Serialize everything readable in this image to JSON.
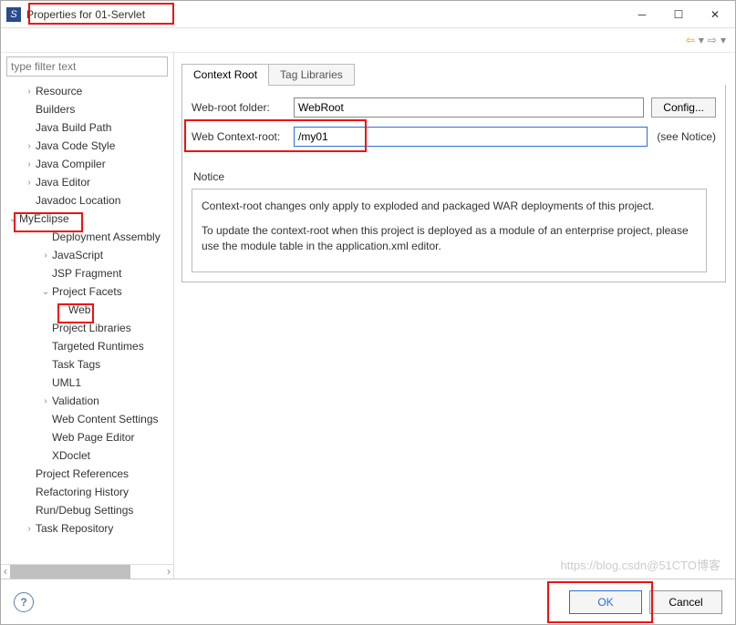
{
  "window": {
    "title": "Properties for 01-Servlet"
  },
  "filter": {
    "placeholder": "type filter text"
  },
  "tree": {
    "items": [
      {
        "label": "Resource",
        "indent": 1,
        "twisty": ">"
      },
      {
        "label": "Builders",
        "indent": 1,
        "twisty": ""
      },
      {
        "label": "Java Build Path",
        "indent": 1,
        "twisty": ""
      },
      {
        "label": "Java Code Style",
        "indent": 1,
        "twisty": ">"
      },
      {
        "label": "Java Compiler",
        "indent": 1,
        "twisty": ">"
      },
      {
        "label": "Java Editor",
        "indent": 1,
        "twisty": ">"
      },
      {
        "label": "Javadoc Location",
        "indent": 1,
        "twisty": ""
      },
      {
        "label": "MyEclipse",
        "indent": 0,
        "twisty": "v"
      },
      {
        "label": "Deployment Assembly",
        "indent": 2,
        "twisty": ""
      },
      {
        "label": "JavaScript",
        "indent": 2,
        "twisty": ">"
      },
      {
        "label": "JSP Fragment",
        "indent": 2,
        "twisty": ""
      },
      {
        "label": "Project Facets",
        "indent": 2,
        "twisty": "v"
      },
      {
        "label": "Web",
        "indent": 3,
        "twisty": ""
      },
      {
        "label": "Project Libraries",
        "indent": 2,
        "twisty": ""
      },
      {
        "label": "Targeted Runtimes",
        "indent": 2,
        "twisty": ""
      },
      {
        "label": "Task Tags",
        "indent": 2,
        "twisty": ""
      },
      {
        "label": "UML1",
        "indent": 2,
        "twisty": ""
      },
      {
        "label": "Validation",
        "indent": 2,
        "twisty": ">"
      },
      {
        "label": "Web Content Settings",
        "indent": 2,
        "twisty": ""
      },
      {
        "label": "Web Page Editor",
        "indent": 2,
        "twisty": ""
      },
      {
        "label": "XDoclet",
        "indent": 2,
        "twisty": ""
      },
      {
        "label": "Project References",
        "indent": 1,
        "twisty": ""
      },
      {
        "label": "Refactoring History",
        "indent": 1,
        "twisty": ""
      },
      {
        "label": "Run/Debug Settings",
        "indent": 1,
        "twisty": ""
      },
      {
        "label": "Task Repository",
        "indent": 1,
        "twisty": ">"
      }
    ]
  },
  "tabs": {
    "items": [
      {
        "label": "Context Root",
        "active": true
      },
      {
        "label": "Tag Libraries",
        "active": false
      }
    ]
  },
  "form": {
    "webroot_label": "Web-root folder:",
    "webroot_value": "WebRoot",
    "config_btn": "Config...",
    "contextroot_label": "Web Context-root:",
    "contextroot_value": "/my01",
    "see_notice": "(see Notice)"
  },
  "notice": {
    "heading": "Notice",
    "p1": "Context-root changes only apply to exploded and packaged WAR deployments of this project.",
    "p2": "To update the context-root when this project is deployed as a module of an enterprise project, please use the module table in the application.xml editor."
  },
  "buttons": {
    "ok": "OK",
    "cancel": "Cancel"
  },
  "watermark": "https://blog.csdn@51CTO博客"
}
